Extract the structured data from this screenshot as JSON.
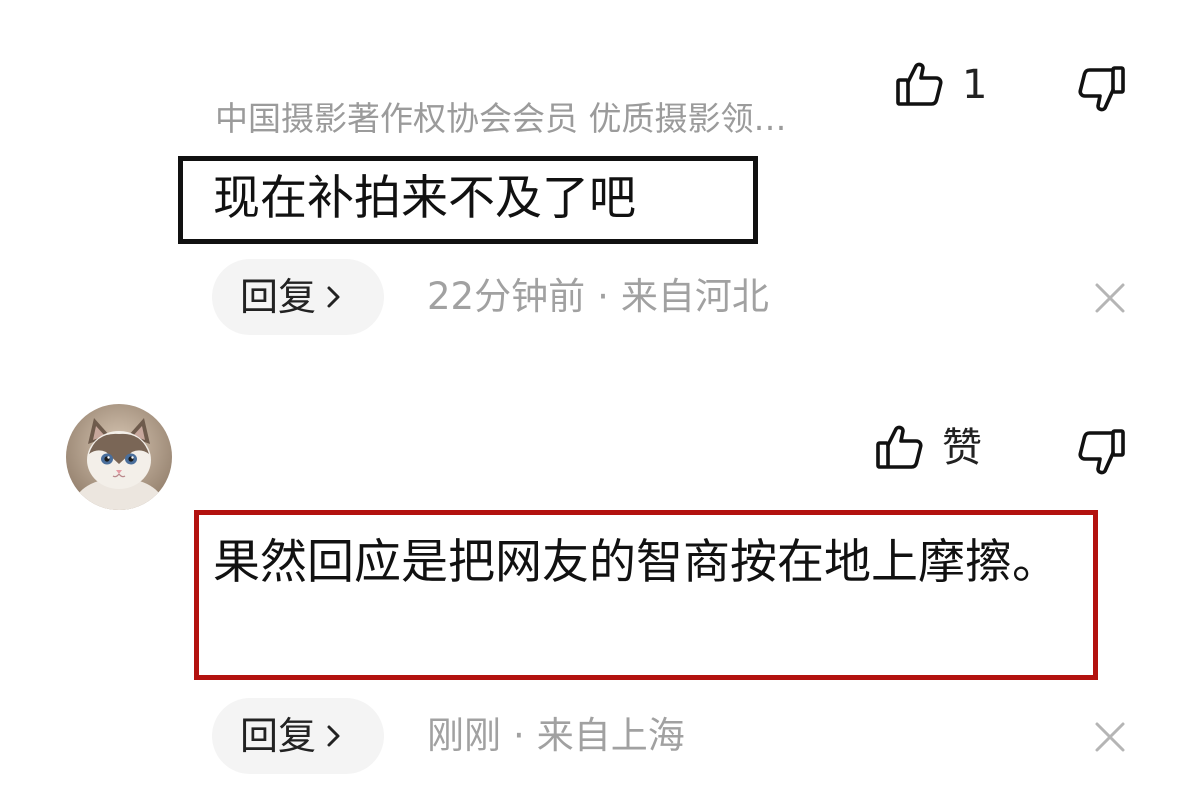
{
  "comments": [
    {
      "subtitle": "中国摄影著作权协会会员 优质摄影领…",
      "text": "现在补拍来不及了吧",
      "like_count": "1",
      "reply_label": "回复",
      "time": "22分钟前",
      "separator": "·",
      "location": "来自河北",
      "highlight_color": "#111111"
    },
    {
      "text": "果然回应是把网友的智商按在地上摩擦。",
      "like_count": "赞",
      "reply_label": "回复",
      "time": "刚刚",
      "separator": "·",
      "location": "来自上海",
      "highlight_color": "#b3120f",
      "avatar": "cat-avatar"
    }
  ],
  "icons": {
    "like": "thumbs-up-icon",
    "dislike": "thumbs-down-icon",
    "reply_chevron": "chevron-right-icon",
    "close": "close-icon"
  }
}
